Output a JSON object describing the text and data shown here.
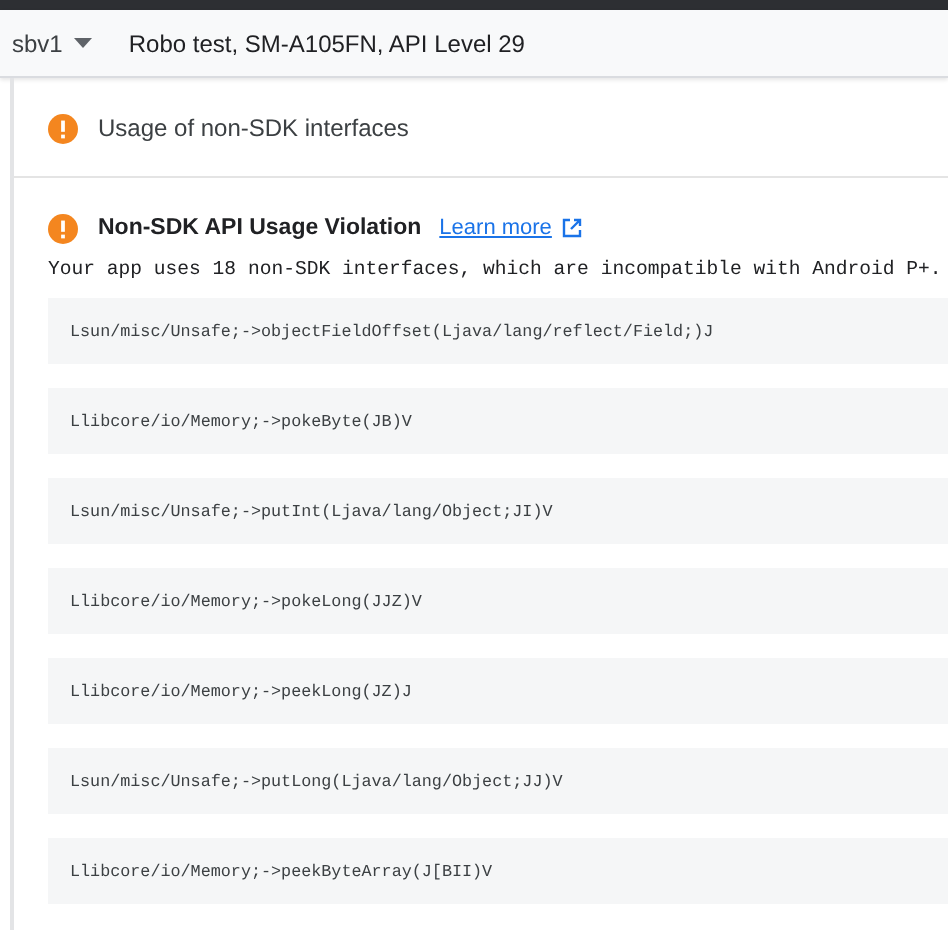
{
  "header": {
    "selector": "sbv1",
    "title": "Robo test, SM-A105FN, API Level 29"
  },
  "issue_summary": {
    "label": "Usage of non-SDK interfaces"
  },
  "violation": {
    "title": "Non-SDK API Usage Violation",
    "link": "Learn more",
    "description": "Your app uses 18 non-SDK interfaces, which are incompatible with Android P+.",
    "interfaces": [
      "Lsun/misc/Unsafe;->objectFieldOffset(Ljava/lang/reflect/Field;)J",
      "Llibcore/io/Memory;->pokeByte(JB)V",
      "Lsun/misc/Unsafe;->putInt(Ljava/lang/Object;JI)V",
      "Llibcore/io/Memory;->pokeLong(JJZ)V",
      "Llibcore/io/Memory;->peekLong(JZ)J",
      "Lsun/misc/Unsafe;->putLong(Ljava/lang/Object;JJ)V",
      "Llibcore/io/Memory;->peekByteArray(J[BII)V"
    ]
  }
}
